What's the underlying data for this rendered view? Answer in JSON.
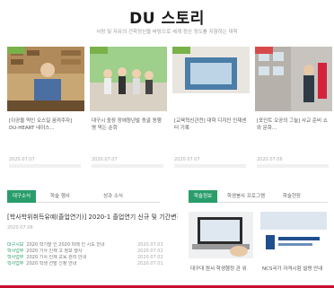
{
  "header": {
    "title": "DU 스토리",
    "subtitle": "사랑 및 자유의 건학정신을 바탕으로 세계 정신 정도를 지향하는 대학"
  },
  "cards": [
    {
      "caption": "[이공을 먹인 오스일 꿈켜주자] DU-HEART 네이스...",
      "date": "2020.07.07",
      "tag_color": "#7ab24a"
    },
    {
      "caption": "대구시 중장 장애청년발 동골 동행 명 먹는 순회",
      "date": "2020.07.07",
      "tag_color": "#7ab24a"
    },
    {
      "caption": "[교육혁신관전] 대학 디지인 인재센터 기록",
      "date": "2020.07.07",
      "tag_color": "#7ab24a"
    },
    {
      "caption": "[포인트 오공의 그늘] 사교 준비 쇼와 문화...",
      "date": "2020.07.06",
      "tag_color": "#d84a4a"
    }
  ],
  "left_tabs": [
    {
      "label": "대구소식"
    },
    {
      "label": "학술 행사"
    },
    {
      "label": "성과 소식"
    }
  ],
  "right_tabs": [
    {
      "label": "학술정보"
    },
    {
      "label": "학생봉사 프로그램"
    },
    {
      "label": "학술현장"
    }
  ],
  "notice": {
    "title": "[학사학위취득유예(졸업연기)] 2020-1 졸업연기 신규 및 기간변경 신청 안내",
    "date": "2020.07.06"
  },
  "news": [
    {
      "kind": "대구시보",
      "text": "2020 학기말 인 2020 미래 인 시도 안내",
      "date": "2020.07.03"
    },
    {
      "kind": "학사업무",
      "text": "2020 기사 인재 고 정보 행사",
      "date": "2020.07.02"
    },
    {
      "kind": "학사업무",
      "text": "2020 기사 인재 교육 관리 안내",
      "date": "2020.07.02"
    },
    {
      "kind": "학사업무",
      "text": "2020 학생 선발 신청 안내",
      "date": "2020.07.01"
    }
  ],
  "bottom_cards": [
    {
      "caption": "대구대 원서 학생행정 관 위"
    },
    {
      "caption": "NCS국가 자격시험 설명 안내"
    }
  ],
  "colors": {
    "accent_green": "#2a9d6b",
    "tag_green": "#7ab24a",
    "tag_red": "#d84a4a",
    "brand_red": "#c8102e"
  }
}
